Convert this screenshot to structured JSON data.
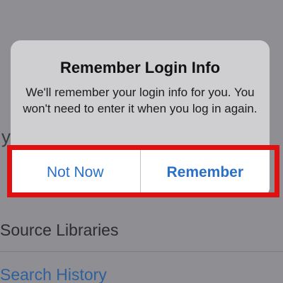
{
  "background": {
    "partial_label": "y",
    "rows": [
      {
        "label": "Source Libraries"
      },
      {
        "label": "Search History"
      }
    ]
  },
  "alert": {
    "title": "Remember Login Info",
    "message": "We'll remember your login info for you. You won't need to enter it when you log in again.",
    "buttons": {
      "not_now": "Not Now",
      "remember": "Remember"
    }
  },
  "colors": {
    "accent": "#2a70c7",
    "highlight": "#e01010",
    "dim_background": "#8f8f93"
  }
}
